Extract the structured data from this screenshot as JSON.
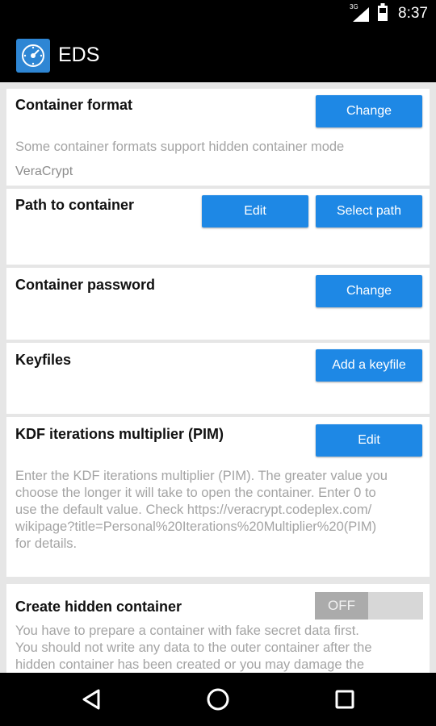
{
  "status_bar": {
    "network_label": "3G",
    "time": "8:37"
  },
  "app_bar": {
    "title": "EDS"
  },
  "sections": {
    "container_format": {
      "title": "Container format",
      "button": "Change",
      "description": "Some container formats support hidden container mode",
      "value": "VeraCrypt"
    },
    "path_to_container": {
      "title": "Path to container",
      "edit_button": "Edit",
      "select_button": "Select path"
    },
    "container_password": {
      "title": "Container password",
      "button": "Change"
    },
    "keyfiles": {
      "title": "Keyfiles",
      "button": "Add a keyfile"
    },
    "kdf": {
      "title": "KDF iterations multiplier (PIM)",
      "button": "Edit",
      "description_lines": [
        "Enter the KDF iterations multiplier (PIM). The greater value you",
        "choose the longer it will take to open the container. Enter 0 to",
        "use the default value. Check https://veracrypt.codeplex.com/",
        "wikipage?title=Personal%20Iterations%20Multiplier%20(PIM)",
        "for details."
      ]
    },
    "hidden_container": {
      "title": "Create hidden container",
      "toggle_label": "OFF",
      "description_lines": [
        "You have to prepare a container with fake secret data first.",
        "You should not write any data to the outer container after the",
        "hidden container has been created or you may damage the"
      ]
    }
  },
  "colors": {
    "accent": "#1e88e5",
    "background": "#e6e6e6",
    "secondary_text": "#a4a4a4"
  },
  "icons": {
    "app": "eds-logo-icon",
    "signal": "signal-icon",
    "battery": "battery-icon",
    "back": "back-triangle-icon",
    "home": "home-circle-icon",
    "recents": "recents-square-icon"
  }
}
